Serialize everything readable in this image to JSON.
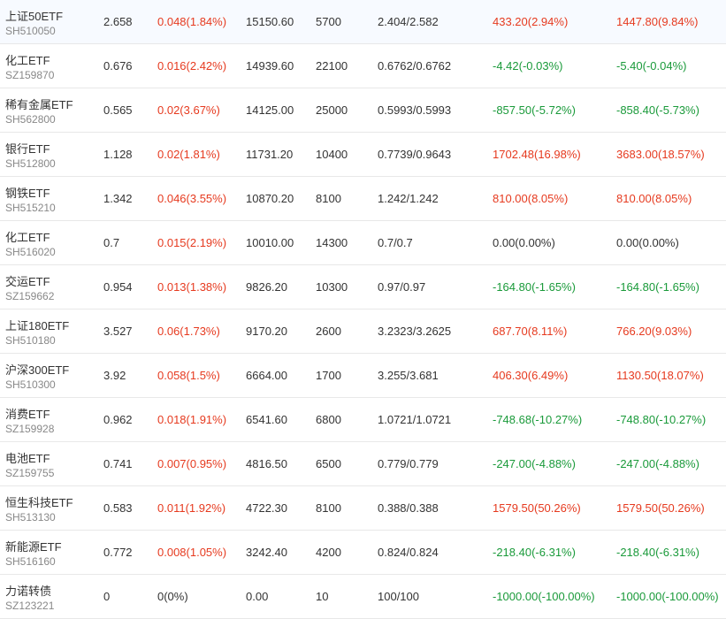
{
  "colors": {
    "up": "#e63a1f",
    "down": "#1a9a3a",
    "flat": "#333333"
  },
  "rows": [
    {
      "name": "上证50ETF",
      "code": "SH510050",
      "price": "2.658",
      "change": "0.048(1.84%)",
      "change_dir": "up",
      "market_value": "15150.60",
      "quantity": "5700",
      "cost": "2.404/2.582",
      "pnl": "433.20(2.94%)",
      "pnl_dir": "up",
      "total_pnl": "1447.80(9.84%)",
      "total_dir": "up"
    },
    {
      "name": "化工ETF",
      "code": "SZ159870",
      "price": "0.676",
      "change": "0.016(2.42%)",
      "change_dir": "up",
      "market_value": "14939.60",
      "quantity": "22100",
      "cost": "0.6762/0.6762",
      "pnl": "-4.42(-0.03%)",
      "pnl_dir": "down",
      "total_pnl": "-5.40(-0.04%)",
      "total_dir": "down"
    },
    {
      "name": "稀有金属ETF",
      "code": "SH562800",
      "price": "0.565",
      "change": "0.02(3.67%)",
      "change_dir": "up",
      "market_value": "14125.00",
      "quantity": "25000",
      "cost": "0.5993/0.5993",
      "pnl": "-857.50(-5.72%)",
      "pnl_dir": "down",
      "total_pnl": "-858.40(-5.73%)",
      "total_dir": "down"
    },
    {
      "name": "银行ETF",
      "code": "SH512800",
      "price": "1.128",
      "change": "0.02(1.81%)",
      "change_dir": "up",
      "market_value": "11731.20",
      "quantity": "10400",
      "cost": "0.7739/0.9643",
      "pnl": "1702.48(16.98%)",
      "pnl_dir": "up",
      "total_pnl": "3683.00(18.57%)",
      "total_dir": "up"
    },
    {
      "name": "钢铁ETF",
      "code": "SH515210",
      "price": "1.342",
      "change": "0.046(3.55%)",
      "change_dir": "up",
      "market_value": "10870.20",
      "quantity": "8100",
      "cost": "1.242/1.242",
      "pnl": "810.00(8.05%)",
      "pnl_dir": "up",
      "total_pnl": "810.00(8.05%)",
      "total_dir": "up"
    },
    {
      "name": "化工ETF",
      "code": "SH516020",
      "price": "0.7",
      "change": "0.015(2.19%)",
      "change_dir": "up",
      "market_value": "10010.00",
      "quantity": "14300",
      "cost": "0.7/0.7",
      "pnl": "0.00(0.00%)",
      "pnl_dir": "flat",
      "total_pnl": "0.00(0.00%)",
      "total_dir": "flat"
    },
    {
      "name": "交运ETF",
      "code": "SZ159662",
      "price": "0.954",
      "change": "0.013(1.38%)",
      "change_dir": "up",
      "market_value": "9826.20",
      "quantity": "10300",
      "cost": "0.97/0.97",
      "pnl": "-164.80(-1.65%)",
      "pnl_dir": "down",
      "total_pnl": "-164.80(-1.65%)",
      "total_dir": "down"
    },
    {
      "name": "上证180ETF",
      "code": "SH510180",
      "price": "3.527",
      "change": "0.06(1.73%)",
      "change_dir": "up",
      "market_value": "9170.20",
      "quantity": "2600",
      "cost": "3.2323/3.2625",
      "pnl": "687.70(8.11%)",
      "pnl_dir": "up",
      "total_pnl": "766.20(9.03%)",
      "total_dir": "up"
    },
    {
      "name": "沪深300ETF",
      "code": "SH510300",
      "price": "3.92",
      "change": "0.058(1.5%)",
      "change_dir": "up",
      "market_value": "6664.00",
      "quantity": "1700",
      "cost": "3.255/3.681",
      "pnl": "406.30(6.49%)",
      "pnl_dir": "up",
      "total_pnl": "1130.50(18.07%)",
      "total_dir": "up"
    },
    {
      "name": "消费ETF",
      "code": "SZ159928",
      "price": "0.962",
      "change": "0.018(1.91%)",
      "change_dir": "up",
      "market_value": "6541.60",
      "quantity": "6800",
      "cost": "1.0721/1.0721",
      "pnl": "-748.68(-10.27%)",
      "pnl_dir": "down",
      "total_pnl": "-748.80(-10.27%)",
      "total_dir": "down"
    },
    {
      "name": "电池ETF",
      "code": "SZ159755",
      "price": "0.741",
      "change": "0.007(0.95%)",
      "change_dir": "up",
      "market_value": "4816.50",
      "quantity": "6500",
      "cost": "0.779/0.779",
      "pnl": "-247.00(-4.88%)",
      "pnl_dir": "down",
      "total_pnl": "-247.00(-4.88%)",
      "total_dir": "down"
    },
    {
      "name": "恒生科技ETF",
      "code": "SH513130",
      "price": "0.583",
      "change": "0.011(1.92%)",
      "change_dir": "up",
      "market_value": "4722.30",
      "quantity": "8100",
      "cost": "0.388/0.388",
      "pnl": "1579.50(50.26%)",
      "pnl_dir": "up",
      "total_pnl": "1579.50(50.26%)",
      "total_dir": "up"
    },
    {
      "name": "新能源ETF",
      "code": "SH516160",
      "price": "0.772",
      "change": "0.008(1.05%)",
      "change_dir": "up",
      "market_value": "3242.40",
      "quantity": "4200",
      "cost": "0.824/0.824",
      "pnl": "-218.40(-6.31%)",
      "pnl_dir": "down",
      "total_pnl": "-218.40(-6.31%)",
      "total_dir": "down"
    },
    {
      "name": "力诺转债",
      "code": "SZ123221",
      "price": "0",
      "change": "0(0%)",
      "change_dir": "flat",
      "market_value": "0.00",
      "quantity": "10",
      "cost": "100/100",
      "pnl": "-1000.00(-100.00%)",
      "pnl_dir": "down",
      "total_pnl": "-1000.00(-100.00%)",
      "total_dir": "down"
    }
  ]
}
